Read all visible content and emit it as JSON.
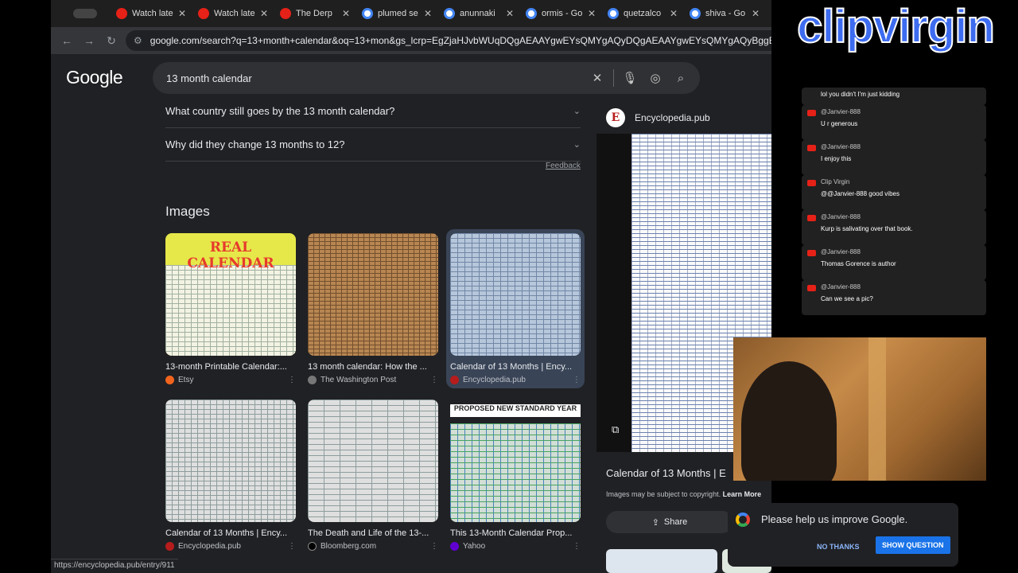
{
  "browser": {
    "tabs": [
      {
        "label": "Watch late",
        "favicon": "youtube-icon"
      },
      {
        "label": "Watch late",
        "favicon": "youtube-icon"
      },
      {
        "label": "The Derp",
        "favicon": "youtube-icon"
      },
      {
        "label": "plumed se",
        "favicon": "google-icon"
      },
      {
        "label": "anunnaki",
        "favicon": "google-icon"
      },
      {
        "label": "ormis - Go",
        "favicon": "google-icon"
      },
      {
        "label": "quetzalco",
        "favicon": "google-icon"
      },
      {
        "label": "shiva - Go",
        "favicon": "google-icon"
      }
    ],
    "url": "google.com/search?q=13+month+calendar&oq=13+mon&gs_lcrp=EgZjaHJvbWUqDQgAEAAYgwEYsQMYgAQyDQgAEAAYgwEYsQMYgAQyBggBEEUY"
  },
  "google": {
    "logo": "Google",
    "query": "13 month calendar",
    "people_also_ask": [
      "What country still goes by the 13 month calendar?",
      "Why did they change 13 months to 12?"
    ],
    "feedback": "Feedback",
    "images_heading": "Images",
    "images": [
      {
        "caption": "13-month Printable Calendar:...",
        "source": "Etsy",
        "source_color": "#f1641e",
        "source_letter": "E"
      },
      {
        "caption": "13 month calendar: How the ...",
        "source": "The Washington Post",
        "source_color": "#444444",
        "source_letter": "W"
      },
      {
        "caption": "Calendar of 13 Months | Ency...",
        "source": "Encyclopedia.pub",
        "source_color": "#b71c1c",
        "source_letter": "E"
      },
      {
        "caption": "Calendar of 13 Months | Ency...",
        "source": "Encyclopedia.pub",
        "source_color": "#b71c1c",
        "source_letter": "E"
      },
      {
        "caption": "The Death and Life of the 13-...",
        "source": "Bloomberg.com",
        "source_color": "#000000",
        "source_letter": "B"
      },
      {
        "caption": "This 13-Month Calendar Prop...",
        "source": "Yahoo",
        "source_color": "#6001d2",
        "source_letter": "Y"
      }
    ],
    "thumb_texts": {
      "real_calendar": "REAL CALENDAR",
      "proposed": "PROPOSED NEW STANDARD YEAR"
    },
    "preview": {
      "source": "Encyclopedia.pub",
      "badge": "E",
      "title": "Calendar of 13 Months | E",
      "copyright": "Images may be subject to copyright.",
      "learn_more": "Learn More",
      "share": "Share"
    },
    "status_url": "https://encyclopedia.pub/entry/911"
  },
  "overlay": {
    "brand": "clipvirgin",
    "chat": [
      {
        "user": "",
        "message": "lol you didn't I'm just kidding"
      },
      {
        "user": "@Janvier-888",
        "message": "U r generous"
      },
      {
        "user": "@Janvier-888",
        "message": "I enjoy this"
      },
      {
        "user": "Clip Virgin",
        "message": "@@Janvier-888 good vibes"
      },
      {
        "user": "@Janvier-888",
        "message": "Kurp is salivating over that book."
      },
      {
        "user": "@Janvier-888",
        "message": "Thomas Gorence is author"
      },
      {
        "user": "@Janvier-888",
        "message": "Can we see a pic?"
      }
    ],
    "survey": {
      "question": "Please help us improve Google.",
      "no": "NO THANKS",
      "yes": "SHOW QUESTION"
    }
  }
}
